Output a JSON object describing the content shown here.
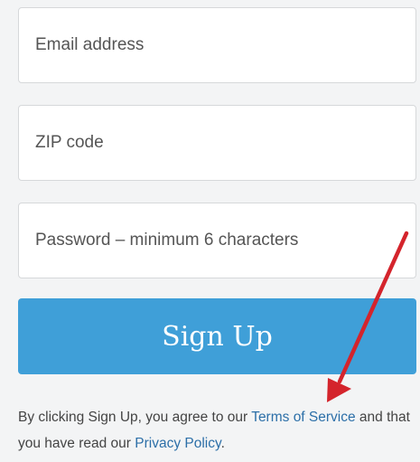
{
  "form": {
    "email_placeholder": "Email address",
    "zip_placeholder": "ZIP code",
    "password_placeholder": "Password – minimum 6 characters",
    "signup_label": "Sign Up"
  },
  "legal": {
    "prefix": "By clicking Sign Up, you agree to our ",
    "terms_link": "Terms of Service",
    "middle": " and that you have read our ",
    "privacy_link": "Privacy Policy",
    "suffix": "."
  },
  "colors": {
    "button": "#3f9fd8",
    "link": "#2c6fa8",
    "arrow": "#d4242c"
  },
  "annotation": {
    "icon": "red-arrow-icon"
  }
}
